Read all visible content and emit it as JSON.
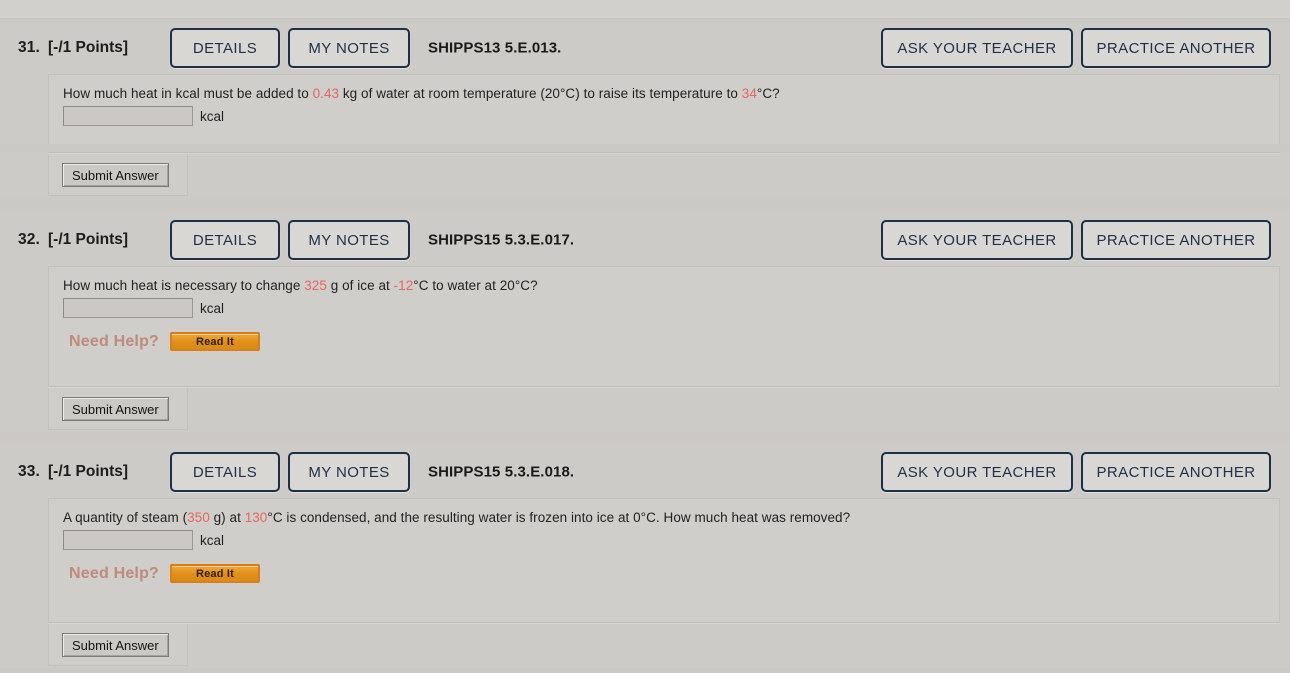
{
  "meta": {
    "accent_red": "#e8655f",
    "button_navy": "#1d3048",
    "readit_orange": "#e08e17",
    "page_bg": "#ccc9c5"
  },
  "common": {
    "details_label": "DETAILS",
    "my_notes_label": "MY NOTES",
    "ask_teacher_label": "ASK YOUR TEACHER",
    "practice_another_label": "PRACTICE ANOTHER",
    "submit_label": "Submit Answer",
    "need_help_label": "Need Help?",
    "read_it_label": "Read It",
    "unit_label": "kcal",
    "answer_placeholder": ""
  },
  "questions": [
    {
      "number": "31.",
      "points": "[-/1 Points]",
      "code": "SHIPPS13 5.E.013.",
      "text_parts": [
        {
          "t": "How much heat in kcal must be added to ",
          "hl": false
        },
        {
          "t": "0.43",
          "hl": true
        },
        {
          "t": " kg of water at room temperature (20°C) to raise its temperature to ",
          "hl": false
        },
        {
          "t": "34",
          "hl": true
        },
        {
          "t": "°C?",
          "hl": false
        }
      ],
      "answer_value": "",
      "unit": "kcal",
      "has_need_help": false
    },
    {
      "number": "32.",
      "points": "[-/1 Points]",
      "code": "SHIPPS15 5.3.E.017.",
      "text_parts": [
        {
          "t": "How much heat is necessary to change ",
          "hl": false
        },
        {
          "t": "325",
          "hl": true
        },
        {
          "t": " g of ice at ",
          "hl": false
        },
        {
          "t": "-12",
          "hl": true
        },
        {
          "t": "°C to water at 20°C?",
          "hl": false
        }
      ],
      "answer_value": "",
      "unit": "kcal",
      "has_need_help": true
    },
    {
      "number": "33.",
      "points": "[-/1 Points]",
      "code": "SHIPPS15 5.3.E.018.",
      "text_parts": [
        {
          "t": "A quantity of steam (",
          "hl": false
        },
        {
          "t": "350",
          "hl": true
        },
        {
          "t": " g) at ",
          "hl": false
        },
        {
          "t": "130",
          "hl": true
        },
        {
          "t": "°C is condensed, and the resulting water is frozen into ice at 0°C. How much heat was removed?",
          "hl": false
        }
      ],
      "answer_value": "",
      "unit": "kcal",
      "has_need_help": true
    }
  ]
}
